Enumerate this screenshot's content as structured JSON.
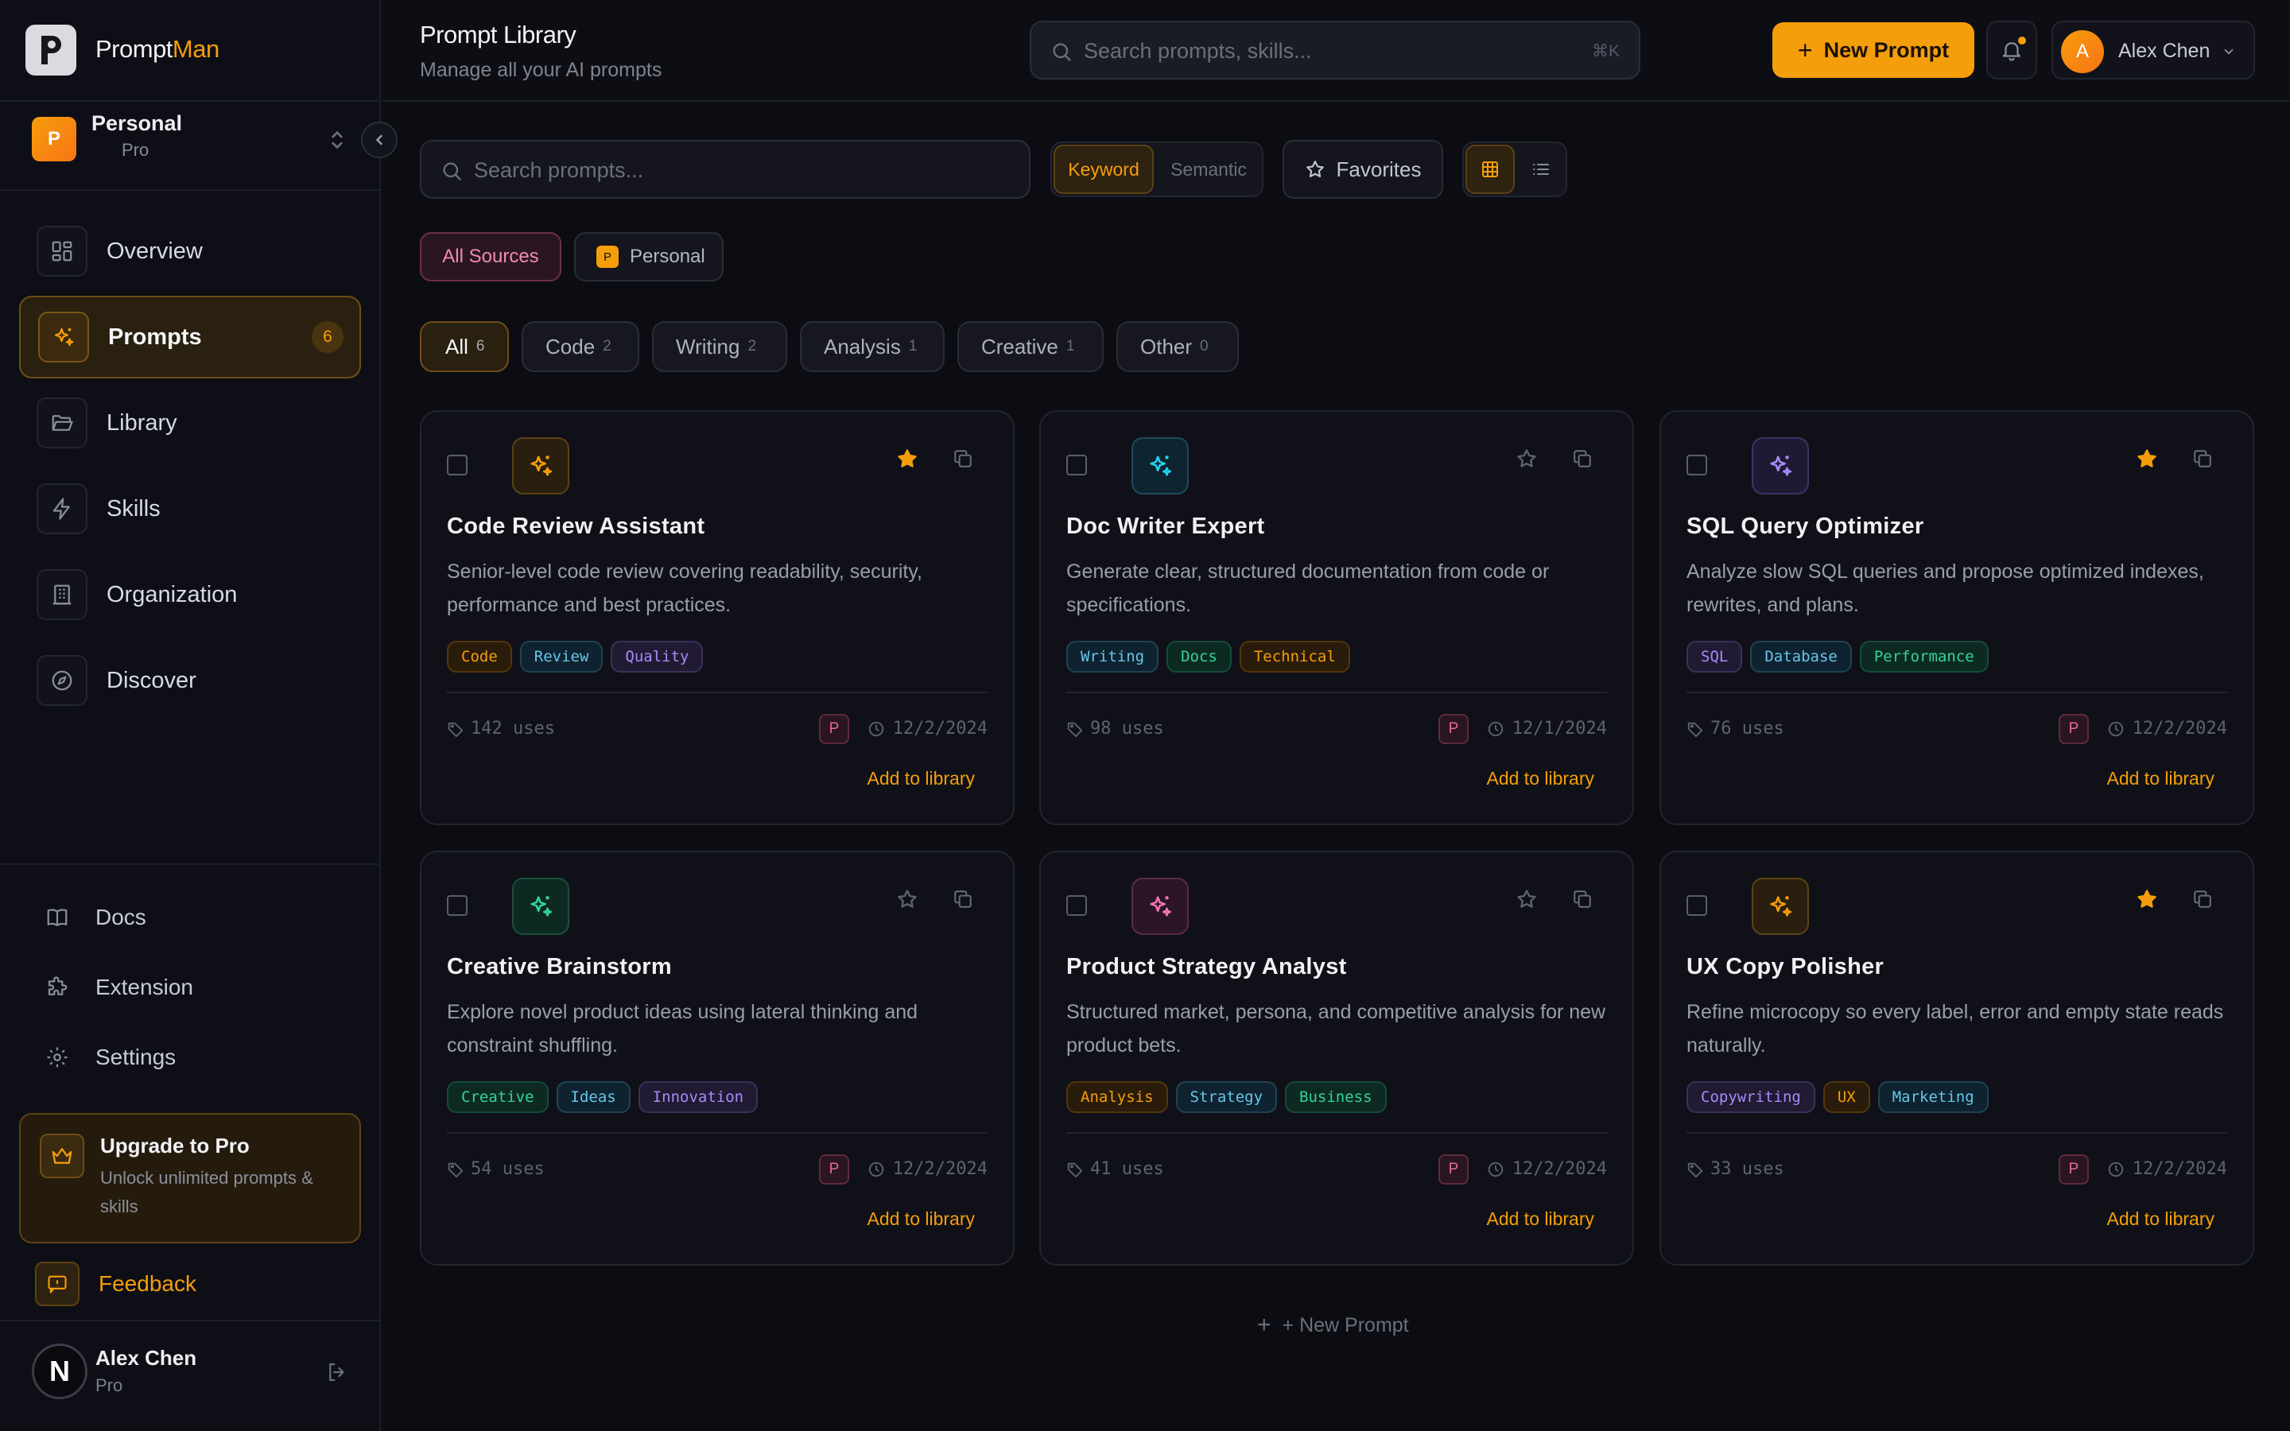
{
  "brand": {
    "name_part1": "Prompt",
    "name_part2": "Man",
    "logo_icon": "p-logo-icon"
  },
  "workspace": {
    "name": "Personal",
    "plan": "Pro",
    "initial": "P"
  },
  "nav": [
    {
      "label": "Overview",
      "icon": "grid-icon"
    },
    {
      "label": "Prompts",
      "icon": "sparkles-icon",
      "count": "6",
      "active": true
    },
    {
      "label": "Library",
      "icon": "folder-open-icon"
    },
    {
      "label": "Skills",
      "icon": "lightning-icon"
    },
    {
      "label": "Organization",
      "icon": "building-icon"
    },
    {
      "label": "Discover",
      "icon": "compass-icon"
    }
  ],
  "footer_nav": [
    {
      "label": "Docs",
      "icon": "book-icon"
    },
    {
      "label": "Extension",
      "icon": "puzzle-icon"
    },
    {
      "label": "Settings",
      "icon": "gear-icon"
    }
  ],
  "upgrade": {
    "title": "Upgrade to Pro",
    "desc": "Unlock unlimited prompts & skills"
  },
  "feedback": {
    "label": "Feedback"
  },
  "sidebar_user": {
    "name": "Alex Chen",
    "plan": "Pro",
    "initial": "N"
  },
  "header": {
    "title": "Prompt Library",
    "subtitle": "Manage all your AI prompts",
    "search_placeholder": "Search prompts, skills...",
    "search_shortcut": "⌘K",
    "new_prompt": "New Prompt",
    "user_name": "Alex Chen",
    "user_initial": "A"
  },
  "toolbar": {
    "search_placeholder": "Search prompts...",
    "mode_keyword": "Keyword",
    "mode_semantic": "Semantic",
    "favorites": "Favorites"
  },
  "sources": {
    "all": "All Sources",
    "personal": "Personal",
    "personal_initial": "P"
  },
  "categories": [
    {
      "label": "All",
      "count": "6"
    },
    {
      "label": "Code",
      "count": "2"
    },
    {
      "label": "Writing",
      "count": "2"
    },
    {
      "label": "Analysis",
      "count": "1"
    },
    {
      "label": "Creative",
      "count": "1"
    },
    {
      "label": "Other",
      "count": "0"
    }
  ],
  "cards": [
    {
      "title": "Code Review Assistant",
      "desc": "Senior-level code review covering readability, security, performance and best practices.",
      "tags": [
        "Code",
        "Review",
        "Quality"
      ],
      "uses": "142 uses",
      "date": "12/2/2024",
      "favorite": true,
      "source": "P",
      "add": "Add to library",
      "icon_color": "#f59e0b"
    },
    {
      "title": "Doc Writer Expert",
      "desc": "Generate clear, structured documentation from code or specifications.",
      "tags": [
        "Writing",
        "Docs",
        "Technical"
      ],
      "uses": "98 uses",
      "date": "12/1/2024",
      "favorite": false,
      "source": "P",
      "add": "Add to library",
      "icon_color": "#22d3ee"
    },
    {
      "title": "SQL Query Optimizer",
      "desc": "Analyze slow SQL queries and propose optimized indexes, rewrites, and plans.",
      "tags": [
        "SQL",
        "Database",
        "Performance"
      ],
      "uses": "76 uses",
      "date": "12/2/2024",
      "favorite": true,
      "source": "P",
      "add": "Add to library",
      "icon_color": "#a78bfa"
    },
    {
      "title": "Creative Brainstorm",
      "desc": "Explore novel product ideas using lateral thinking and constraint shuffling.",
      "tags": [
        "Creative",
        "Ideas",
        "Innovation"
      ],
      "uses": "54 uses",
      "date": "12/2/2024",
      "favorite": false,
      "source": "P",
      "add": "Add to library",
      "icon_color": "#34d399"
    },
    {
      "title": "Product Strategy Analyst",
      "desc": "Structured market, persona, and competitive analysis for new product bets.",
      "tags": [
        "Analysis",
        "Strategy",
        "Business"
      ],
      "uses": "41 uses",
      "date": "12/2/2024",
      "favorite": false,
      "source": "P",
      "add": "Add to library",
      "icon_color": "#f472b6"
    },
    {
      "title": "UX Copy Polisher",
      "desc": "Refine microcopy so every label, error and empty state reads naturally.",
      "tags": [
        "Copywriting",
        "UX",
        "Marketing"
      ],
      "uses": "33 uses",
      "date": "12/2/2024",
      "favorite": true,
      "source": "P",
      "add": "Add to library",
      "icon_color": "#f59e0b"
    }
  ],
  "new_prompt_link": "+ New Prompt",
  "colors": {
    "accent": "#f59e0b",
    "background": "#0c0d13",
    "card": "#101118"
  }
}
